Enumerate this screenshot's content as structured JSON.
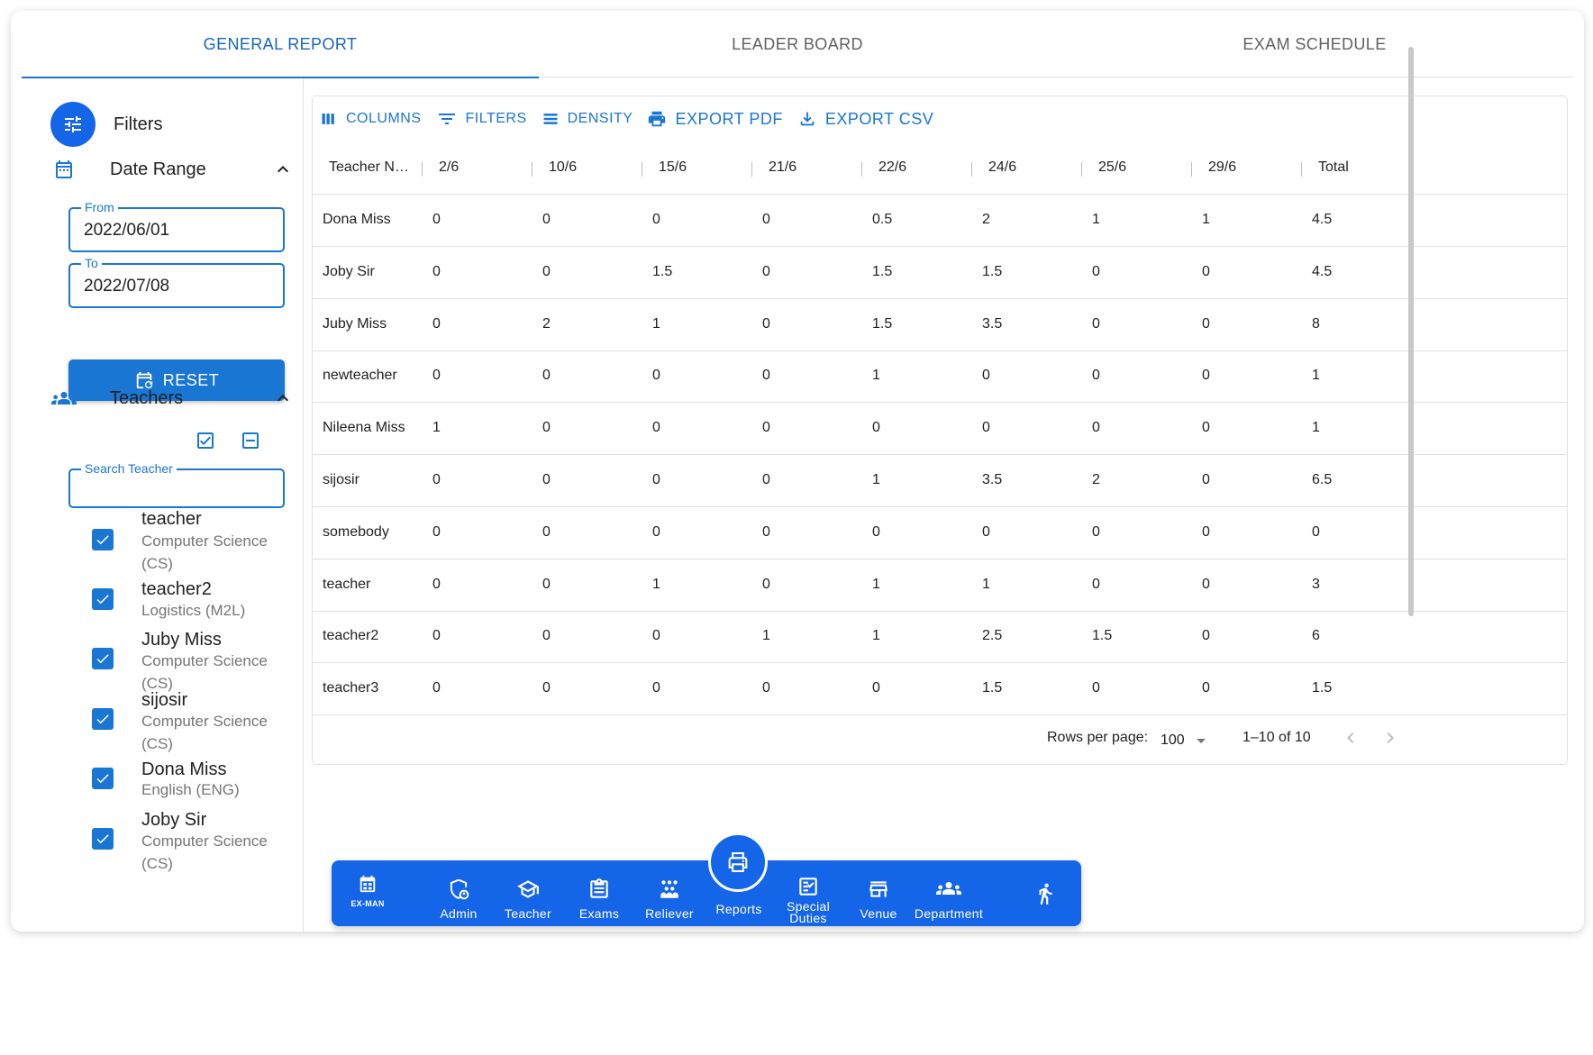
{
  "tabs": [
    "GENERAL REPORT",
    "LEADER BOARD",
    "EXAM SCHEDULE"
  ],
  "sidebar": {
    "filters_title": "Filters",
    "date_range": {
      "label": "Date Range",
      "from_label": "From",
      "from_value": "2022/06/01",
      "to_label": "To",
      "to_value": "2022/07/08",
      "reset_label": "RESET"
    },
    "teachers": {
      "label": "Teachers",
      "search_label": "Search Teacher",
      "search_value": "",
      "items": [
        {
          "name": "teacher",
          "dept": "Computer Science (CS)",
          "checked": true
        },
        {
          "name": "teacher2",
          "dept": "Logistics (M2L)",
          "checked": true
        },
        {
          "name": "Juby Miss",
          "dept": "Computer Science (CS)",
          "checked": true
        },
        {
          "name": "sijosir",
          "dept": "Computer Science (CS)",
          "checked": true
        },
        {
          "name": "Dona Miss",
          "dept": "English (ENG)",
          "checked": true
        },
        {
          "name": "Joby Sir",
          "dept": "Computer Science (CS)",
          "checked": true
        }
      ]
    }
  },
  "toolbar": {
    "columns": "COLUMNS",
    "filters": "FILTERS",
    "density": "DENSITY",
    "export_pdf": "EXPORT PDF",
    "export_csv": "EXPORT CSV"
  },
  "table": {
    "columns": [
      "Teacher N…",
      "2/6",
      "10/6",
      "15/6",
      "21/6",
      "22/6",
      "24/6",
      "25/6",
      "29/6",
      "Total"
    ],
    "rows": [
      [
        "Dona Miss",
        "0",
        "0",
        "0",
        "0",
        "0.5",
        "2",
        "1",
        "1",
        "4.5"
      ],
      [
        "Joby Sir",
        "0",
        "0",
        "1.5",
        "0",
        "1.5",
        "1.5",
        "0",
        "0",
        "4.5"
      ],
      [
        "Juby Miss",
        "0",
        "2",
        "1",
        "0",
        "1.5",
        "3.5",
        "0",
        "0",
        "8"
      ],
      [
        "newteacher",
        "0",
        "0",
        "0",
        "0",
        "1",
        "0",
        "0",
        "0",
        "1"
      ],
      [
        "Nileena Miss",
        "1",
        "0",
        "0",
        "0",
        "0",
        "0",
        "0",
        "0",
        "1"
      ],
      [
        "sijosir",
        "0",
        "0",
        "0",
        "0",
        "1",
        "3.5",
        "2",
        "0",
        "6.5"
      ],
      [
        "somebody",
        "0",
        "0",
        "0",
        "0",
        "0",
        "0",
        "0",
        "0",
        "0"
      ],
      [
        "teacher",
        "0",
        "0",
        "1",
        "0",
        "1",
        "1",
        "0",
        "0",
        "3"
      ],
      [
        "teacher2",
        "0",
        "0",
        "0",
        "1",
        "1",
        "2.5",
        "1.5",
        "0",
        "6"
      ],
      [
        "teacher3",
        "0",
        "0",
        "0",
        "0",
        "0",
        "1.5",
        "0",
        "0",
        "1.5"
      ]
    ],
    "footer": {
      "rows_per_page_label": "Rows per page:",
      "rows_per_page_value": "100",
      "range": "1–10 of 10"
    }
  },
  "bottom_nav": {
    "logo": "EX-MAN",
    "items": [
      {
        "label": "Admin",
        "icon": "admin-shield-icon"
      },
      {
        "label": "Teacher",
        "icon": "graduation-cap-icon"
      },
      {
        "label": "Exams",
        "icon": "clipboard-list-icon"
      },
      {
        "label": "Reliever",
        "icon": "group-icon"
      },
      {
        "label": "Reports",
        "icon": "printer-icon",
        "active": true
      },
      {
        "label": "Special Duties",
        "icon": "checklist-icon"
      },
      {
        "label": "Venue",
        "icon": "store-icon"
      },
      {
        "label": "Department",
        "icon": "department-people-icon"
      }
    ],
    "accessibility_icon": "walking-person-icon"
  },
  "colors": {
    "primary": "#1976d2",
    "nav_blue": "#1565e8",
    "text": "#212121",
    "muted": "#757575",
    "border": "#e0e0e0"
  }
}
